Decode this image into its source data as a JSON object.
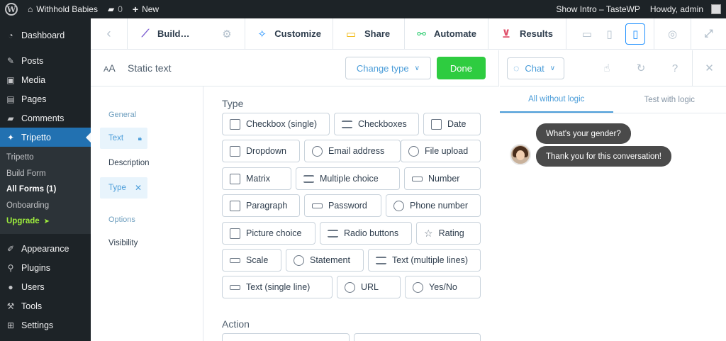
{
  "admin_bar": {
    "site_name": "Withhold Babies",
    "comments_count": "0",
    "new_label": "New",
    "show_intro": "Show Intro – TasteWP",
    "howdy": "Howdy, admin"
  },
  "sidebar": {
    "menu": [
      {
        "label": "Dashboard",
        "icon": "dashboard-icon"
      },
      {
        "label": "Posts",
        "icon": "pin-icon"
      },
      {
        "label": "Media",
        "icon": "media-icon"
      },
      {
        "label": "Pages",
        "icon": "pages-icon"
      },
      {
        "label": "Comments",
        "icon": "comment-icon"
      },
      {
        "label": "Tripetto",
        "icon": "tripetto-icon"
      }
    ],
    "submenu": [
      "Tripetto",
      "Build Form",
      "All Forms (1)",
      "Onboarding",
      "Upgrade"
    ],
    "upgrade_arrow": "➤",
    "menu2": [
      {
        "label": "Appearance",
        "icon": "brush-icon"
      },
      {
        "label": "Plugins",
        "icon": "plug-icon"
      },
      {
        "label": "Users",
        "icon": "user-icon"
      },
      {
        "label": "Tools",
        "icon": "wrench-icon"
      },
      {
        "label": "Settings",
        "icon": "settings-icon"
      }
    ]
  },
  "toolbar": {
    "build": "Build…",
    "customize": "Customize",
    "share": "Share",
    "automate": "Automate",
    "results": "Results"
  },
  "editor": {
    "title": "Static text",
    "change_type": "Change type",
    "done": "Done",
    "nav": {
      "general": "General",
      "text": "Text",
      "description": "Description",
      "type": "Type",
      "options": "Options",
      "visibility": "Visibility"
    },
    "type_section": "Type",
    "types": [
      "Checkbox (single)",
      "Checkboxes",
      "Date",
      "Dropdown",
      "Email address",
      "File upload",
      "Matrix",
      "Multiple choice",
      "Number",
      "Paragraph",
      "Password",
      "Phone number",
      "Picture choice",
      "Radio buttons",
      "Rating",
      "Scale",
      "Statement",
      "Text (multiple lines)",
      "Text (single line)",
      "URL",
      "Yes/No"
    ],
    "action_section": "Action"
  },
  "preview": {
    "mode": "Chat",
    "tabs": [
      "All without logic",
      "Test with logic"
    ],
    "messages": [
      "What's your gender?",
      "Thank you for this conversation!"
    ]
  },
  "colors": {
    "wp_dark": "#1d2327",
    "wp_blue": "#2271b1",
    "accent_blue": "#4b9dd9",
    "done_green": "#2ecc40",
    "upgrade_green": "#9eed3d"
  }
}
